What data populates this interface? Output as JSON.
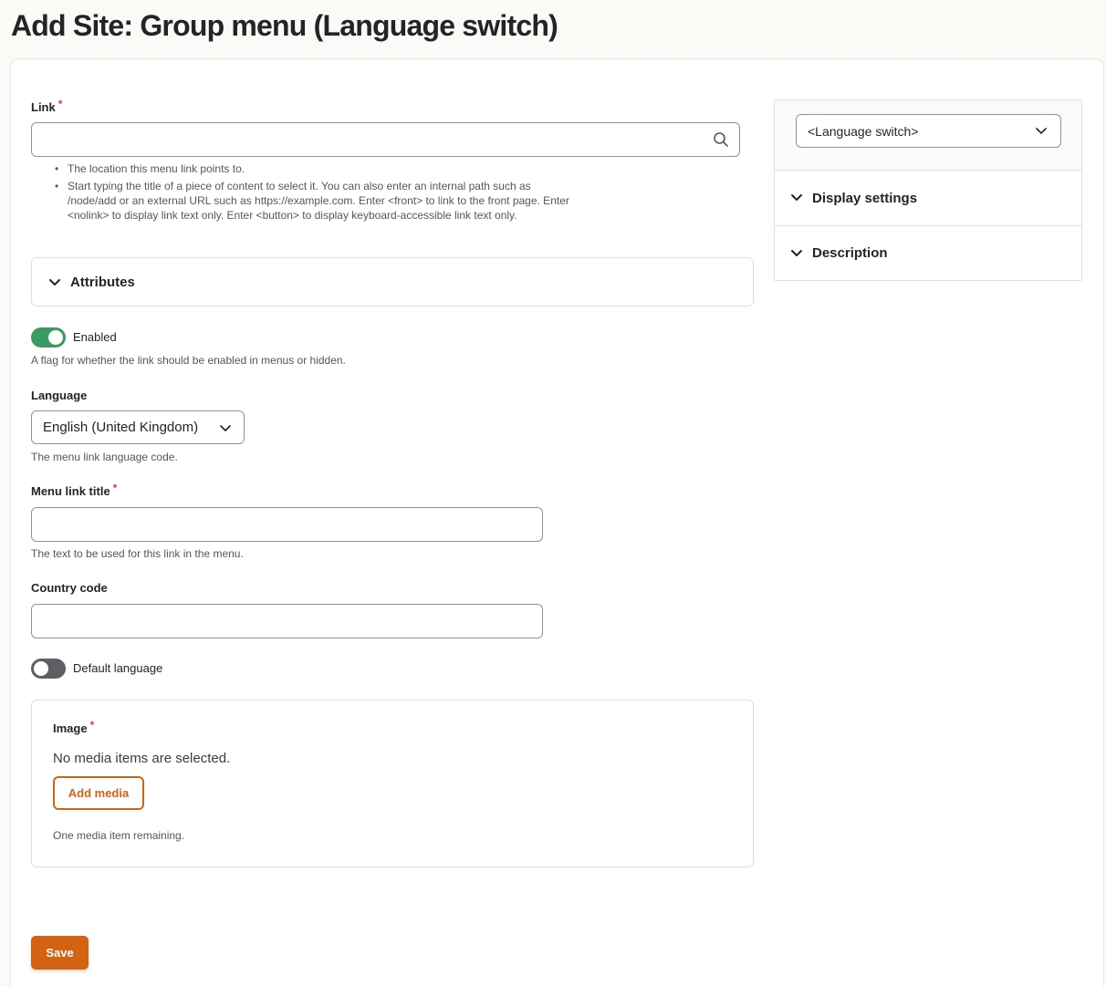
{
  "page": {
    "title": "Add Site: Group menu (Language switch)"
  },
  "colors": {
    "accent": "#d46213",
    "toggle_on": "#3a9a64",
    "toggle_off": "#5e5f63",
    "required": "#cc3d3d"
  },
  "link_field": {
    "label": "Link",
    "required_mark": "*",
    "value": "",
    "icon": "search-icon",
    "help": [
      "The location this menu link points to.",
      "Start typing the title of a piece of content to select it. You can also enter an internal path such as /node/add or an external URL such as https://example.com. Enter <front> to link to the front page. Enter <nolink> to display link text only. Enter <button> to display keyboard-accessible link text only."
    ]
  },
  "attributes": {
    "label": "Attributes",
    "icon": "chevron-down-icon"
  },
  "enabled": {
    "label": "Enabled",
    "on": true,
    "description": "A flag for whether the link should be enabled in menus or hidden."
  },
  "language": {
    "label": "Language",
    "selected": "English (United Kingdom)",
    "description": "The menu link language code."
  },
  "menu_title": {
    "label": "Menu link title",
    "required_mark": "*",
    "value": "",
    "description": "The text to be used for this link in the menu."
  },
  "country_code": {
    "label": "Country code",
    "value": ""
  },
  "default_language": {
    "label": "Default language",
    "on": false
  },
  "image": {
    "label": "Image",
    "required_mark": "*",
    "empty_text": "No media items are selected.",
    "add_button": "Add media",
    "remaining": "One media item remaining."
  },
  "save_button": "Save",
  "sidebar": {
    "menu_select": "<Language switch>",
    "sections": [
      {
        "label": "Display settings"
      },
      {
        "label": "Description"
      }
    ]
  }
}
